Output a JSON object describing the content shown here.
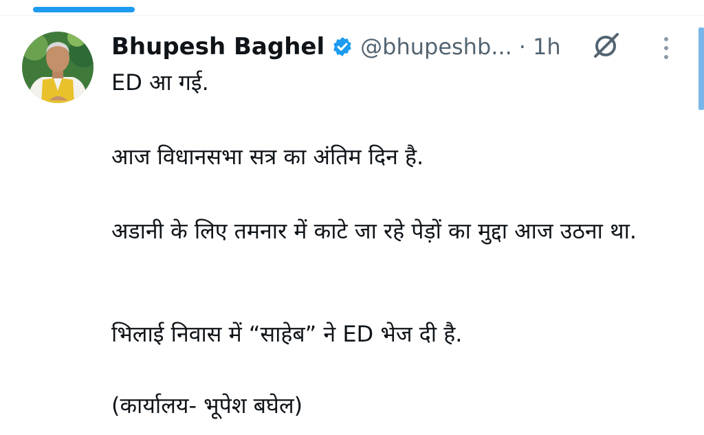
{
  "tweet": {
    "author_name": "Bhupesh Baghel",
    "handle": "@bhupeshb...",
    "separator": "·",
    "time": "1h",
    "paragraphs": [
      "ED आ गई.",
      "आज विधानसभा सत्र का अंतिम दिन है.",
      "अडानी के लिए तमनार में काटे जा रहे पेड़ों का मुद्दा आज उठना था.",
      "भिलाई निवास में “साहेब” ने ED भेज दी है.",
      "(कार्यालय- भूपेश बघेल)"
    ]
  },
  "icons": {
    "verified": "verified-badge-icon",
    "grok": "grok-icon",
    "more": "more-options-icon"
  },
  "colors": {
    "accent": "#1d9bf0",
    "text": "#0f1419",
    "secondary_text": "#536471",
    "avatar_vest": "#e8c12b"
  }
}
